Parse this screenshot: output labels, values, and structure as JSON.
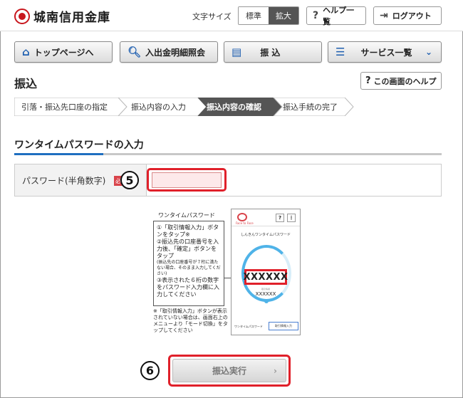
{
  "header": {
    "bank_name": "城南信用金庫",
    "fontsize_label": "文字サイズ",
    "fontsize_options": [
      "標準",
      "拡大"
    ],
    "help_label": "ヘルプ一覧",
    "logout_label": "ログアウト"
  },
  "nav": {
    "items": [
      "トップページへ",
      "入出金明細照会",
      "振 込",
      "サービス一覧"
    ]
  },
  "page": {
    "title": "振込",
    "help_label": "この画面のヘルプ"
  },
  "steps": [
    "引落・振込先口座の指定",
    "振込内容の入力",
    "振込内容の確認",
    "振込手続の完了"
  ],
  "otp": {
    "section_title": "ワンタイムパスワードの入力",
    "field_label": "パスワード(半角数字)",
    "required_tag": "必須",
    "badge_5": "5",
    "badge_6": "6"
  },
  "illustration": {
    "title": "ワンタイムパスワード",
    "step1": "①「取引情報入力」ボタンをタップ※",
    "step2": "②振込先の口座番号を入力後、「確定」ボタンをタップ",
    "step2_note": "(振込先の口座番号が７桁に満たない場合、そのまま入力してください)",
    "step3": "③表示された６桁の数字をパスワード入力欄に入力してください",
    "note": "※「取引情報入力」ボタンが表示されていない場合は、画面右上のメニューより「モード切換」をタップしてください",
    "app_logo": "Face to Face",
    "app_title": "しんきんワンタイムパスワード",
    "code": "XXXXXX",
    "code_sub": "取引情報",
    "code_small": "XXXXXX",
    "footer_left": "ワンタイムパスワード",
    "footer_btn": "取引情報入力"
  },
  "execute": {
    "label": "振込実行"
  },
  "colors": {
    "accent": "#1f6fc0",
    "highlight": "#e0202a",
    "required": "#d9434a"
  }
}
